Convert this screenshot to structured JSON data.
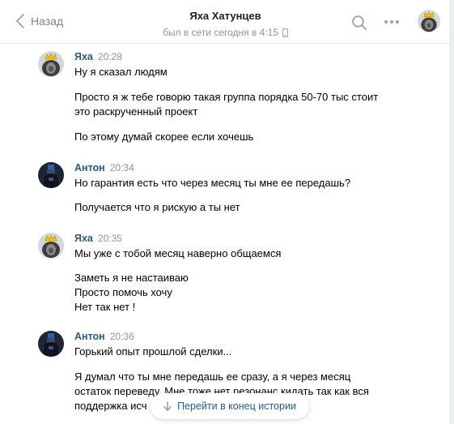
{
  "header": {
    "back_label": "Назад",
    "peer_name": "Яха Хатунцев",
    "peer_status": "был в сети сегодня в 4:15",
    "status_device_icon": "mobile-phone-icon",
    "search_icon": "search-icon",
    "more_icon": "more-dots-icon"
  },
  "messages": [
    {
      "author": "Яха",
      "time": "20:28",
      "avatar": "lion-crown-avatar",
      "lines": [
        "Ну я сказал людям",
        "Просто я ж тебе говорю такая группа порядка 50-70 тыс стоит",
        "это раскрученный проект",
        "По этому думай скорее если хочешь"
      ]
    },
    {
      "author": "Антон",
      "time": "20:34",
      "avatar": "bottle-avatar",
      "lines": [
        "Но гарантия есть что через месяц ты мне ее передашь?",
        "Получается что я рискую а ты нет"
      ]
    },
    {
      "author": "Яха",
      "time": "20:35",
      "avatar": "lion-crown-avatar",
      "lines": [
        "Мы уже с тобой месяц наверно общаемся",
        "Заметь я не настаиваю",
        "Просто помочь хочу",
        "Нет так нет !"
      ]
    },
    {
      "author": "Антон",
      "time": "20:36",
      "avatar": "bottle-avatar",
      "lines": [
        "Горький опыт прошлой сделки...",
        "Я думал что ты мне передашь ее сразу, а я через месяц",
        "остаток переведу. Мне тоже нет резонанс кидать так как вся",
        "поддержка исч"
      ]
    }
  ],
  "jump_button": {
    "label": "Перейти в конец истории",
    "icon": "arrow-down-icon"
  },
  "colors": {
    "link": "#2a5885",
    "muted": "#939393",
    "background": "#edeef0"
  }
}
